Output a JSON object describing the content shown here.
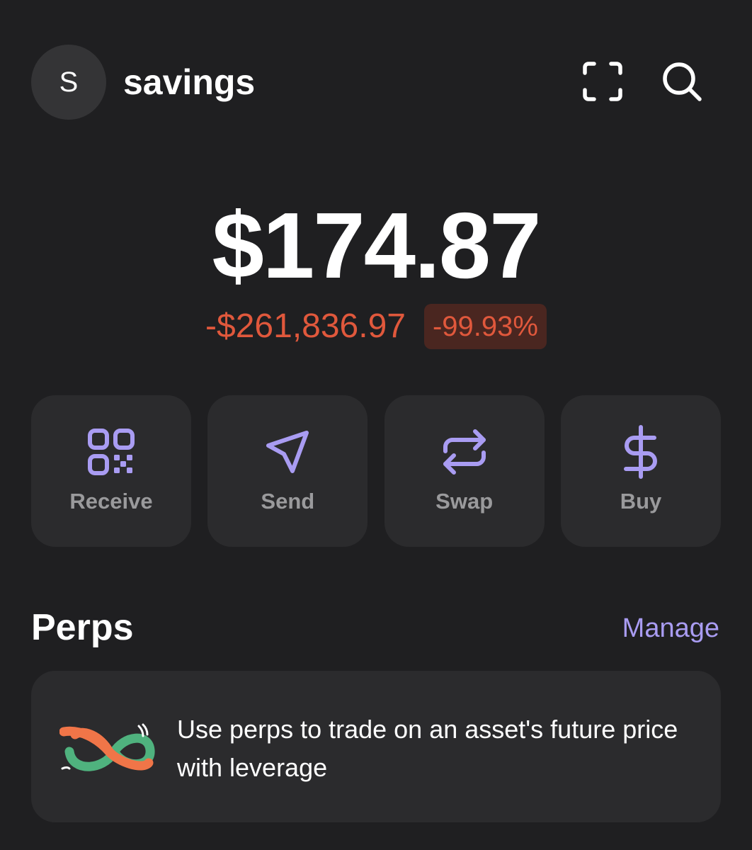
{
  "header": {
    "avatar_initial": "S",
    "account_name": "savings",
    "scan_icon": "scan-frame-icon",
    "search_icon": "search-icon"
  },
  "balance": {
    "total": "$174.87",
    "change_amount": "-$261,836.97",
    "change_percent": "-99.93%"
  },
  "actions": [
    {
      "label": "Receive",
      "icon": "qr-code-icon"
    },
    {
      "label": "Send",
      "icon": "send-arrow-icon"
    },
    {
      "label": "Swap",
      "icon": "swap-arrows-icon"
    },
    {
      "label": "Buy",
      "icon": "dollar-icon"
    }
  ],
  "perps": {
    "title": "Perps",
    "manage_label": "Manage",
    "promo_text": "Use perps to trade on an asset's future price with leverage",
    "logo_icon": "perps-infinity-logo"
  },
  "colors": {
    "background": "#1f1f21",
    "card": "#2b2b2d",
    "accent": "#a99cf2",
    "negative": "#e0583c",
    "negative_bg": "#4a2620",
    "muted_text": "#9a9a9c"
  }
}
